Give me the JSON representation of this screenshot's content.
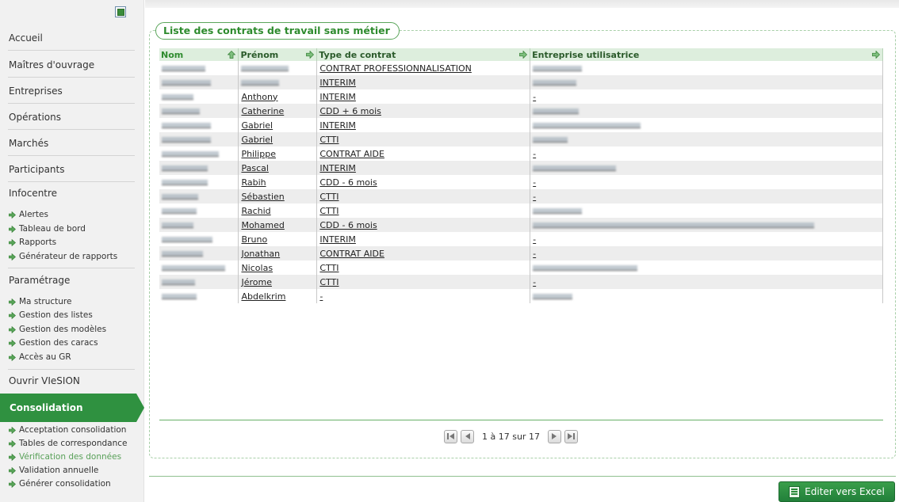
{
  "sidebar": {
    "sections": {
      "accueil": "Accueil",
      "maitres": "Maîtres d'ouvrage",
      "entreprises": "Entreprises",
      "operations": "Opérations",
      "marches": "Marchés",
      "participants": "Participants",
      "infocentre": "Infocentre",
      "parametrage": "Paramétrage",
      "ouvrir": "Ouvrir VIeSION",
      "consolidation": "Consolidation"
    },
    "infocentre_items": [
      "Alertes",
      "Tableau de bord",
      "Rapports",
      "Générateur de rapports"
    ],
    "parametrage_items": [
      "Ma structure",
      "Gestion des listes",
      "Gestion des modèles",
      "Gestion des caracs",
      "Accès au GR"
    ],
    "consolidation_items": [
      "Acceptation consolidation",
      "Tables de correspondance",
      "Vérification des données",
      "Validation annuelle",
      "Générer consolidation"
    ],
    "active_item": "Vérification des données"
  },
  "panel": {
    "title": "Liste des contrats de travail sans métier"
  },
  "table": {
    "headers": {
      "nom": "Nom",
      "prenom": "Prénom",
      "type": "Type de contrat",
      "entreprise": "Entreprise utilisatrice"
    },
    "rows": [
      {
        "prenom": "",
        "type": "CONTRAT PROFESSIONNALISATION",
        "entreprise": ""
      },
      {
        "prenom": "",
        "type": "INTERIM",
        "entreprise": ""
      },
      {
        "prenom": "Anthony",
        "type": "INTERIM",
        "entreprise": "-"
      },
      {
        "prenom": "Catherine",
        "type": "CDD + 6 mois",
        "entreprise": ""
      },
      {
        "prenom": "Gabriel",
        "type": "INTERIM",
        "entreprise": ""
      },
      {
        "prenom": "Gabriel",
        "type": "CTTI",
        "entreprise": ""
      },
      {
        "prenom": "Philippe",
        "type": "CONTRAT AIDE",
        "entreprise": "-"
      },
      {
        "prenom": "Pascal",
        "type": "INTERIM",
        "entreprise": ""
      },
      {
        "prenom": "Rabih",
        "type": "CDD - 6 mois",
        "entreprise": "-"
      },
      {
        "prenom": "Sébastien",
        "type": "CTTI",
        "entreprise": "-"
      },
      {
        "prenom": "Rachid",
        "type": "CTTI",
        "entreprise": ""
      },
      {
        "prenom": "Mohamed",
        "type": "CDD - 6 mois",
        "entreprise": ""
      },
      {
        "prenom": "Bruno",
        "type": "INTERIM",
        "entreprise": "-"
      },
      {
        "prenom": "Jonathan",
        "type": "CONTRAT AIDE",
        "entreprise": "-"
      },
      {
        "prenom": "Nicolas",
        "type": "CTTI",
        "entreprise": ""
      },
      {
        "prenom": "Jérome",
        "type": "CTTI",
        "entreprise": "-"
      },
      {
        "prenom": "Abdelkrim",
        "type": "-",
        "entreprise": ""
      }
    ]
  },
  "pager": {
    "text": "1 à 17 sur 17"
  },
  "actions": {
    "excel_label": "Editer vers Excel"
  },
  "colors": {
    "accent": "#2e8b2e",
    "consolidation_tab": "#2f9140",
    "header_bg": "#ddeedd"
  }
}
